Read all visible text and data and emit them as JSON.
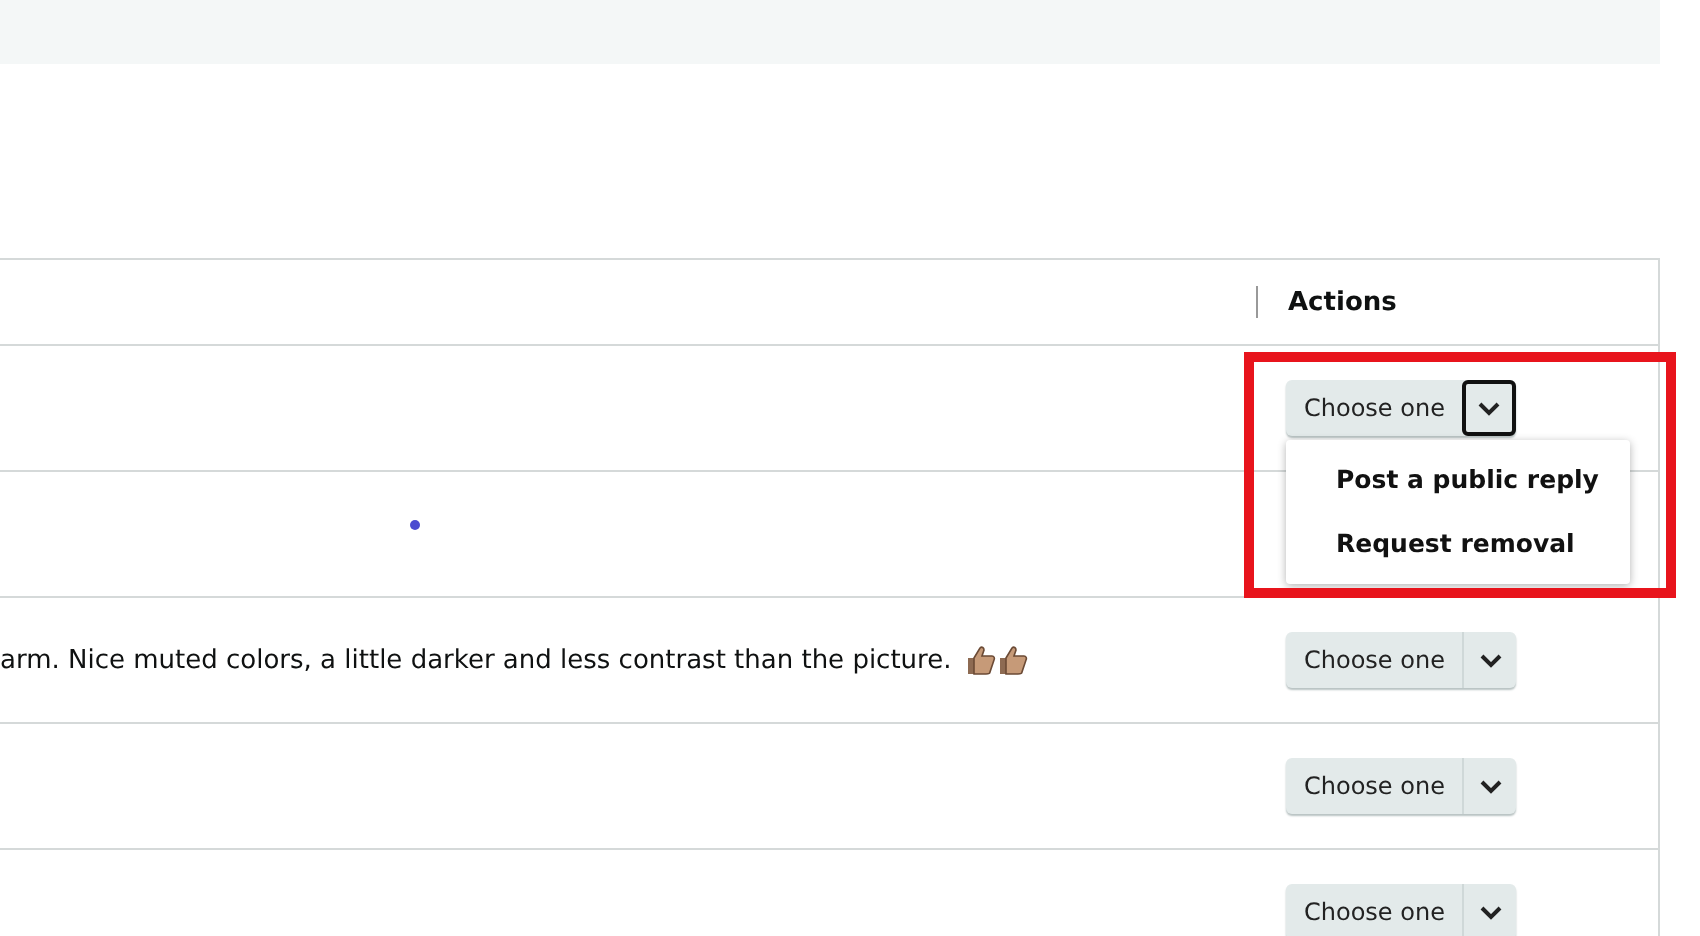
{
  "table": {
    "columns": [
      {
        "label": "Actions"
      }
    ],
    "rows": [
      {
        "comment": "",
        "dot": false,
        "action": {
          "label": "Choose one",
          "expanded": true,
          "menu": [
            "Post a public reply",
            "Request removal"
          ]
        }
      },
      {
        "comment": "",
        "dot": true
      },
      {
        "comment": "arm. Nice muted colors, a little darker and less contrast than the picture.",
        "trailing_icons": [
          {
            "kind": "thumbs-up"
          },
          {
            "kind": "thumbs-up"
          }
        ],
        "dot": false,
        "action": {
          "label": "Choose one",
          "expanded": false
        }
      },
      {
        "comment": "",
        "dot": false,
        "action": {
          "label": "Choose one",
          "expanded": false
        }
      },
      {
        "comment": "",
        "dot": false,
        "action": {
          "label": "Choose one",
          "expanded": false
        }
      }
    ]
  },
  "highlight": {
    "shown": true
  }
}
